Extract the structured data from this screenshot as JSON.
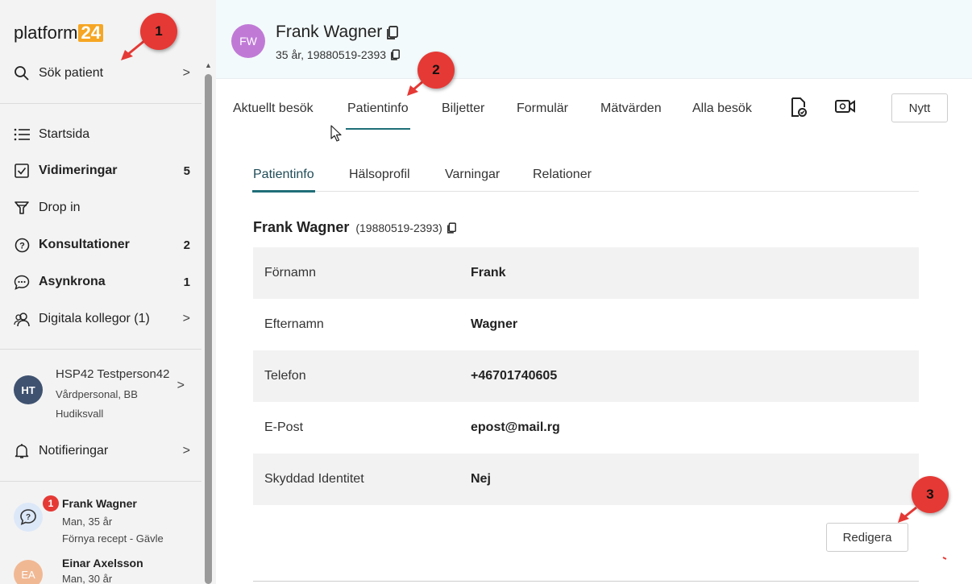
{
  "sidebar": {
    "logo_text": "platform",
    "logo_badge": "24",
    "search_label": "Sök patient",
    "nav": [
      {
        "label": "Startsida",
        "count": "",
        "bold": false
      },
      {
        "label": "Vidimeringar",
        "count": "5",
        "bold": true
      },
      {
        "label": "Drop in",
        "count": "",
        "bold": false
      },
      {
        "label": "Konsultationer",
        "count": "2",
        "bold": true
      },
      {
        "label": "Asynkrona",
        "count": "1",
        "bold": true
      },
      {
        "label": "Digitala kollegor (1)",
        "count": "",
        "bold": false
      }
    ],
    "user": {
      "initials": "HT",
      "name": "HSP42 Testperson42",
      "role": "Vårdpersonal, BB",
      "location": "Hudiksvall"
    },
    "notifications_label": "Notifieringar",
    "queue": [
      {
        "initials": "",
        "name": "Frank Wagner",
        "line2": "Man, 35 år",
        "line3": "Förnya recept - Gävle",
        "badge": "1"
      },
      {
        "initials": "EA",
        "name": "Einar Axelsson",
        "line2": "Man, 30 år",
        "line3": "",
        "badge": ""
      }
    ]
  },
  "header": {
    "initials": "FW",
    "name": "Frank Wagner",
    "info": "35 år, 19880519-2393"
  },
  "tabs": {
    "items": [
      "Aktuellt besök",
      "Patientinfo",
      "Biljetter",
      "Formulär",
      "Mätvärden",
      "Alla besök"
    ],
    "active": "Patientinfo",
    "new_button": "Nytt"
  },
  "subtabs": {
    "items": [
      "Patientinfo",
      "Hälsoprofil",
      "Varningar",
      "Relationer"
    ],
    "active": "Patientinfo"
  },
  "patient": {
    "title": "Frank Wagner",
    "pnr": "(19880519-2393)",
    "fields": [
      {
        "label": "Förnamn",
        "value": "Frank"
      },
      {
        "label": "Efternamn",
        "value": "Wagner"
      },
      {
        "label": "Telefon",
        "value": "+46701740605"
      },
      {
        "label": "E-Post",
        "value": "epost@mail.rg"
      },
      {
        "label": "Skyddad Identitet",
        "value": "Nej"
      }
    ],
    "edit_button": "Redigera"
  },
  "annotations": [
    "1",
    "2",
    "3"
  ],
  "colors": {
    "accent": "#1f6e78",
    "logo_badge": "#f6a623",
    "header_avatar": "#c07ad6",
    "callout": "#e53935"
  }
}
